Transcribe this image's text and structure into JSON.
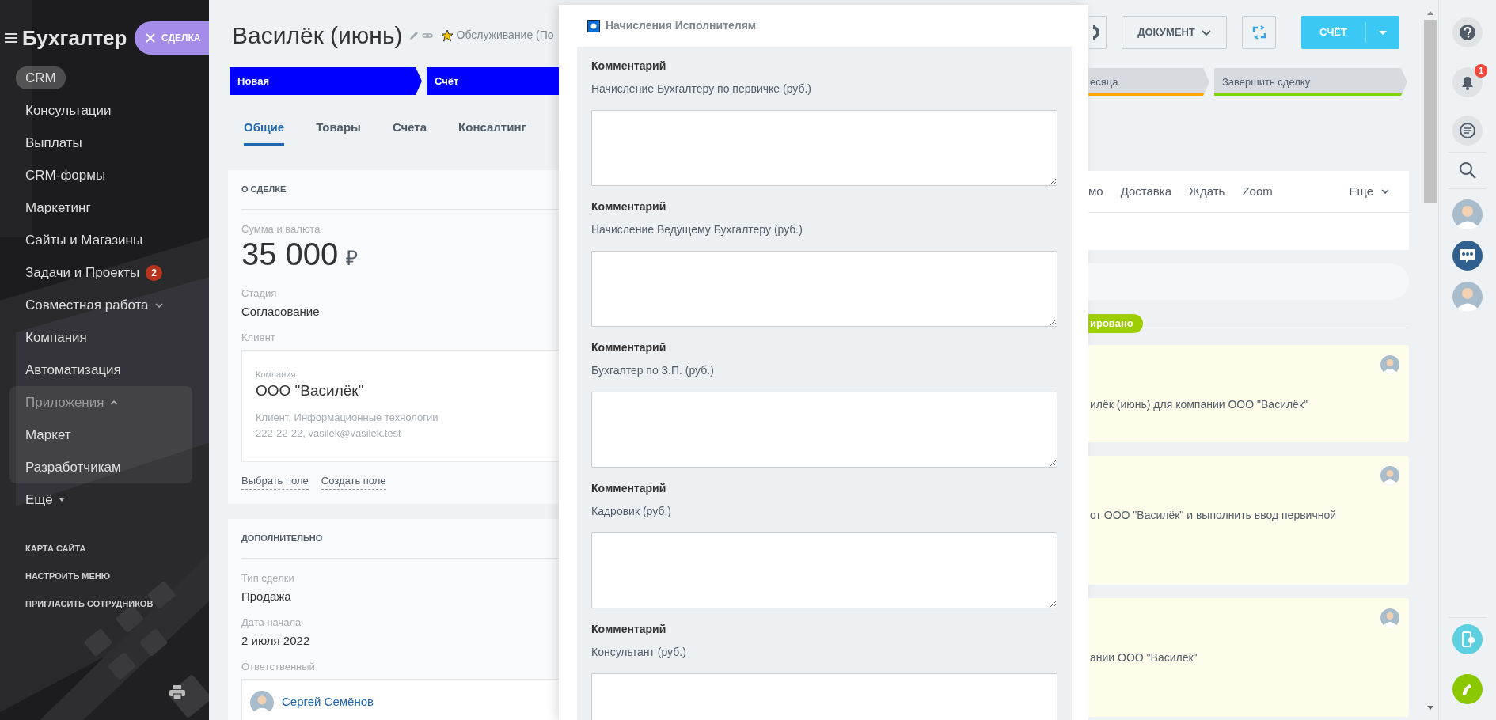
{
  "sidebar": {
    "title": "Бухгалтер",
    "close_button": "СДЕЛКА",
    "items": [
      {
        "kind": "link",
        "label": "CRM",
        "selected": true
      },
      {
        "kind": "link",
        "label": "Консультации",
        "selected": false
      },
      {
        "kind": "link",
        "label": "Выплаты",
        "selected": false
      },
      {
        "kind": "link",
        "label": "CRM-формы",
        "selected": false
      },
      {
        "kind": "link",
        "label": "Маркетинг",
        "selected": false
      },
      {
        "kind": "link",
        "label": "Сайты и Магазины",
        "selected": false
      },
      {
        "kind": "link",
        "label": "Задачи и Проекты",
        "selected": false,
        "badge": "2"
      },
      {
        "kind": "group",
        "label": "Совместная работа",
        "selected": false,
        "expanded": false
      },
      {
        "kind": "link",
        "label": "Компания",
        "selected": false
      },
      {
        "kind": "link",
        "label": "Автоматизация",
        "selected": false
      },
      {
        "kind": "group",
        "label": "Приложения",
        "selected": false,
        "expanded": true,
        "children": [
          {
            "label": "Маркет",
            "selected": false
          },
          {
            "label": "Разработчикам",
            "selected": false
          }
        ]
      },
      {
        "kind": "more",
        "label": "Ещё",
        "selected": false
      }
    ],
    "footer_links": [
      "КАРТА САЙТА",
      "НАСТРОИТЬ МЕНЮ",
      "ПРИГЛАСИТЬ СОТРУДНИКОВ"
    ]
  },
  "deal": {
    "title": "Василёк (июнь)",
    "category": "Обслуживание (По",
    "stages": [
      {
        "label": "Новая",
        "color": "#0000ff",
        "filled": true
      },
      {
        "label": "Счёт",
        "color": "#0000ff",
        "filled": true
      }
    ],
    "tabs": [
      {
        "label": "Общие",
        "selected": true
      },
      {
        "label": "Товары",
        "selected": false
      },
      {
        "label": "Счета",
        "selected": false
      },
      {
        "label": "Консалтинг",
        "selected": false
      }
    ],
    "about": {
      "heading": "О СДЕЛКЕ",
      "amount_label": "Сумма и валюта",
      "amount": "35 000",
      "currency": "₽",
      "stage_label": "Стадия",
      "stage": "Согласование",
      "client_label": "Клиент",
      "client": {
        "type": "Компания",
        "name": "ООО \"Василёк\"",
        "details": "Клиент, Информационные технологии",
        "contacts": "222-22-22, vasilek@vasilek.test"
      },
      "actions": [
        "Выбрать поле",
        "Создать поле"
      ]
    },
    "extra": {
      "heading": "ДОПОЛНИТЕЛЬНО",
      "fields": [
        {
          "label": "Тип сделки",
          "value": "Продажа"
        },
        {
          "label": "Дата начала",
          "value": "2 июля 2022"
        }
      ],
      "responsible_label": "Ответственный",
      "responsible": "Сергей Семёнов"
    }
  },
  "popup": {
    "title": "Начисления Исполнителям",
    "fields": [
      {
        "heading": "Комментарий",
        "label": "Начисление Бухгалтеру по первичке (руб.)"
      },
      {
        "heading": "Комментарий",
        "label": "Начисление Ведущему Бухгалтеру (руб.)"
      },
      {
        "heading": "Комментарий",
        "label": "Бухгалтер по З.П. (руб.)"
      },
      {
        "heading": "Комментарий",
        "label": "Кадровик (руб.)"
      },
      {
        "heading": "Комментарий",
        "label": "Консультант (руб.)"
      }
    ]
  },
  "side": {
    "document_button": "ДОКУМЕНТ",
    "primary_button": "СЧЁТ",
    "stages": [
      {
        "label": "есяца",
        "color": "#ffa900",
        "filled": false
      },
      {
        "label": "Завершить сделку",
        "color": "#7bd500",
        "filled": false
      }
    ],
    "timeline_tabs": [
      "мо",
      "Доставка",
      "Ждать",
      "Zoom"
    ],
    "more_tab": "Еще",
    "status": "ировано",
    "entries": [
      {
        "text": "илёк (июнь) для компании ООО \"Василёк\""
      },
      {
        "text": "от ООО \"Василёк\" и выполнить ввод первичной"
      },
      {
        "text": "ании ООО \"Василёк\""
      }
    ]
  },
  "right_panel": {
    "notifications": "1"
  }
}
